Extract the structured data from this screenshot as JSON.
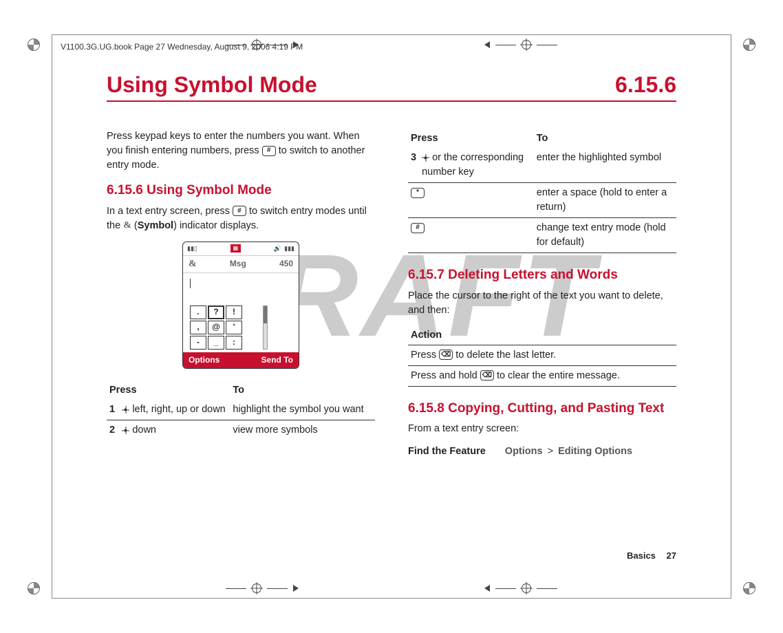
{
  "header_line": "V1100.3G.UG.book  Page 27  Wednesday, August 9, 2006  4:19 PM",
  "watermark": "DRAFT",
  "section": {
    "title": "Using Symbol Mode",
    "number": "6.15.6"
  },
  "left": {
    "intro": "Press keypad keys to enter the numbers you want. When you finish entering numbers, press ",
    "intro_key": "#",
    "intro_after": " to switch to another entry mode.",
    "sub1_title": "6.15.6 Using Symbol Mode",
    "sub1_p1_a": "In a text entry screen, press ",
    "sub1_p1_key": "#",
    "sub1_p1_b": " to switch entry modes until the ",
    "sub1_p1_sym": "&",
    "sub1_p1_symlabel": "Symbol",
    "sub1_p1_c": ") indicator displays.",
    "phone": {
      "title_left": "&",
      "title_center": "Msg",
      "title_right": "450",
      "symbols": [
        ".",
        "?",
        "!",
        ",",
        "@",
        "'",
        "-",
        "_",
        ":"
      ],
      "softkey_left": "Options",
      "softkey_right": "Send To"
    },
    "table": {
      "h_press": "Press",
      "h_to": "To",
      "rows": [
        {
          "n": "1",
          "press": " left, right, up or down",
          "to": "highlight the symbol you want"
        },
        {
          "n": "2",
          "press": " down",
          "to": "view more symbols"
        }
      ]
    }
  },
  "right": {
    "table": {
      "h_press": "Press",
      "h_to": "To",
      "rows": [
        {
          "n": "3",
          "press": " or the corresponding number key",
          "to": "enter the highlighted symbol"
        },
        {
          "key": "*",
          "to": "enter a space (hold to enter a return)"
        },
        {
          "key": "#",
          "to": "change text entry mode (hold for default)"
        }
      ]
    },
    "sub2_title": "6.15.7 Deleting Letters and Words",
    "sub2_p1": "Place the cursor to the right of the text you want to delete, and then:",
    "action_h": "Action",
    "action_r1_a": "Press ",
    "action_r1_key": "⌫",
    "action_r1_b": " to delete the last letter.",
    "action_r2_a": "Press and hold ",
    "action_r2_key": "⌫",
    "action_r2_b": " to clear the entire message.",
    "sub3_title": "6.15.8 Copying, Cutting, and Pasting Text",
    "sub3_p1": "From a text entry screen:",
    "feature_label": "Find the Feature",
    "feature_val_a": "Options",
    "feature_gt": ">",
    "feature_val_b": "Editing Options"
  },
  "footer": {
    "section": "Basics",
    "page": "27"
  }
}
